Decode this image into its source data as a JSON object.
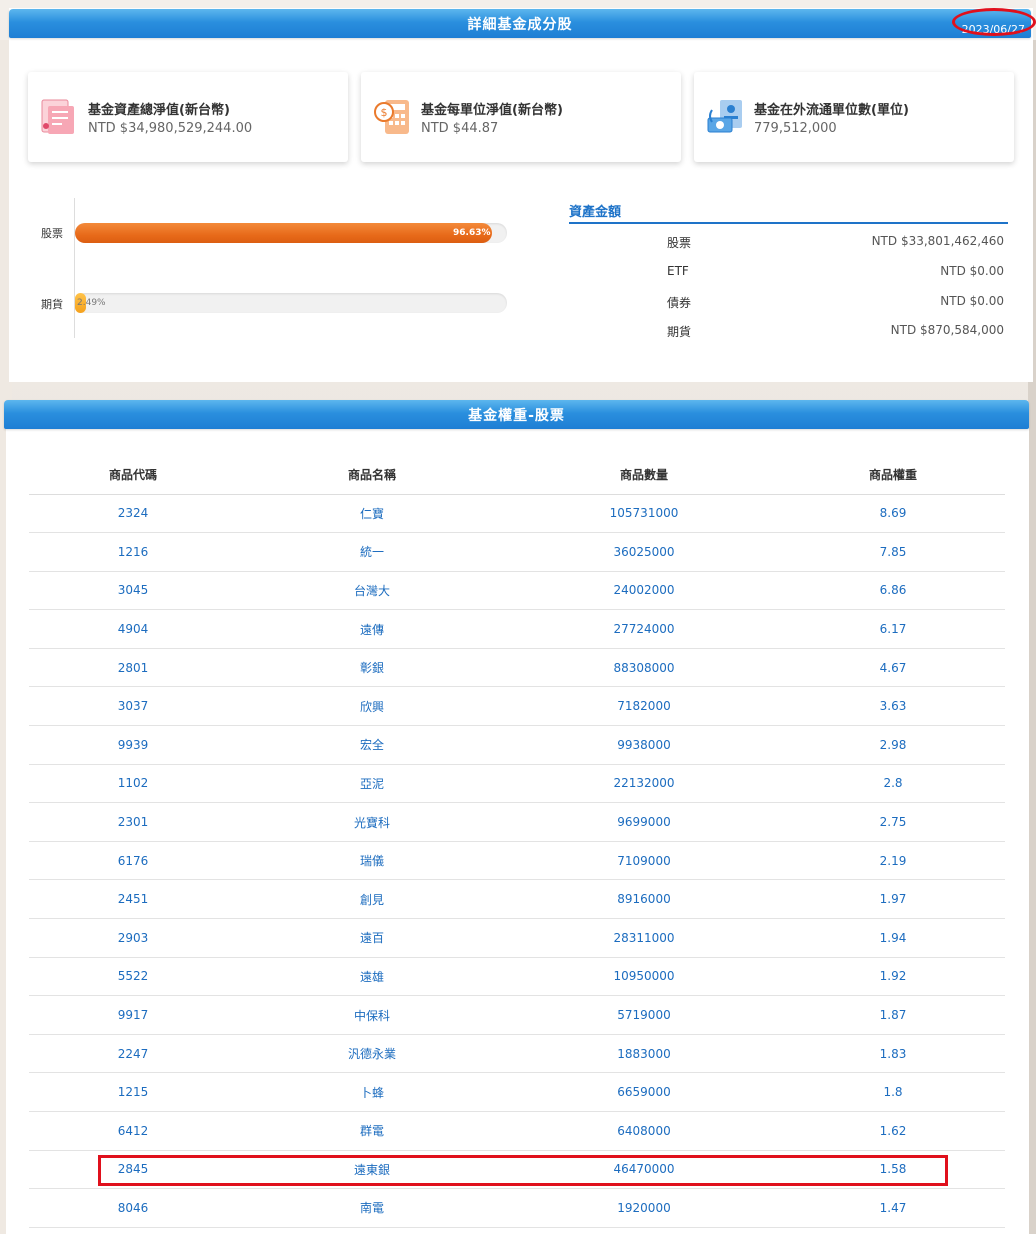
{
  "header": {
    "title": "詳細基金成分股",
    "date": "2023/06/27"
  },
  "cards": [
    {
      "title": "基金資產總淨值(新台幣)",
      "value": "NTD $34,980,529,244.00",
      "icon": "document-chart-icon"
    },
    {
      "title": "基金每單位淨值(新台幣)",
      "value": "NTD $44.87",
      "icon": "calculator-coin-icon"
    },
    {
      "title": "基金在外流通單位數(單位)",
      "value": "779,512,000",
      "icon": "cash-hand-icon"
    }
  ],
  "allocation": [
    {
      "label": "股票",
      "pct_label": "96.63%",
      "pct": 96.63
    },
    {
      "label": "期貨",
      "pct_label": "2.49%",
      "pct": 2.49
    }
  ],
  "assets": {
    "title": "資產金額",
    "rows": [
      {
        "name": "股票",
        "value": "NTD $33,801,462,460"
      },
      {
        "name": "ETF",
        "value": "NTD $0.00"
      },
      {
        "name": "債券",
        "value": "NTD $0.00"
      },
      {
        "name": "期貨",
        "value": "NTD $870,584,000"
      }
    ]
  },
  "holdings": {
    "title": "基金權重-股票",
    "columns": [
      "商品代碼",
      "商品名稱",
      "商品數量",
      "商品權重"
    ],
    "rows": [
      [
        "2324",
        "仁寶",
        "105731000",
        "8.69"
      ],
      [
        "1216",
        "統一",
        "36025000",
        "7.85"
      ],
      [
        "3045",
        "台灣大",
        "24002000",
        "6.86"
      ],
      [
        "4904",
        "遠傳",
        "27724000",
        "6.17"
      ],
      [
        "2801",
        "彰銀",
        "88308000",
        "4.67"
      ],
      [
        "3037",
        "欣興",
        "7182000",
        "3.63"
      ],
      [
        "9939",
        "宏全",
        "9938000",
        "2.98"
      ],
      [
        "1102",
        "亞泥",
        "22132000",
        "2.8"
      ],
      [
        "2301",
        "光寶科",
        "9699000",
        "2.75"
      ],
      [
        "6176",
        "瑞儀",
        "7109000",
        "2.19"
      ],
      [
        "2451",
        "創見",
        "8916000",
        "1.97"
      ],
      [
        "2903",
        "遠百",
        "28311000",
        "1.94"
      ],
      [
        "5522",
        "遠雄",
        "10950000",
        "1.92"
      ],
      [
        "9917",
        "中保科",
        "5719000",
        "1.87"
      ],
      [
        "2247",
        "汎德永業",
        "1883000",
        "1.83"
      ],
      [
        "1215",
        "卜蜂",
        "6659000",
        "1.8"
      ],
      [
        "6412",
        "群電",
        "6408000",
        "1.62"
      ],
      [
        "2845",
        "遠東銀",
        "46470000",
        "1.58"
      ],
      [
        "8046",
        "南電",
        "1920000",
        "1.47"
      ]
    ]
  },
  "colors": {
    "header_blue": "#2a8fde",
    "link_blue": "#1c6cbf",
    "bar_orange": "#e86a1a",
    "bar_yellow": "#f5a11c",
    "annotation_red": "#e0101c"
  }
}
